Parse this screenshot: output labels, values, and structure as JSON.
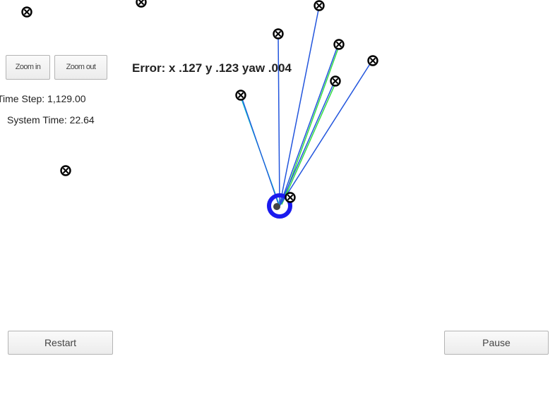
{
  "controls": {
    "zoom_in_label": "Zoom in",
    "zoom_out_label": "Zoom out",
    "restart_label": "Restart",
    "pause_label": "Pause"
  },
  "stats": {
    "time_step": "Time Step: 1,129.00",
    "system_time": "System Time: 22.64"
  },
  "error": {
    "text": "Error: x .127 y .123 yaw .004"
  },
  "colors": {
    "ground_truth_line": "#2255dd",
    "prediction_line": "#33dd44",
    "observation_line": "#11bbcc",
    "vehicle": "#1a1aee",
    "landmark": "#000000",
    "background": "#ffffff"
  },
  "icons": {
    "landmark": "landmark-marker-icon",
    "vehicle": "vehicle-marker-icon"
  }
}
